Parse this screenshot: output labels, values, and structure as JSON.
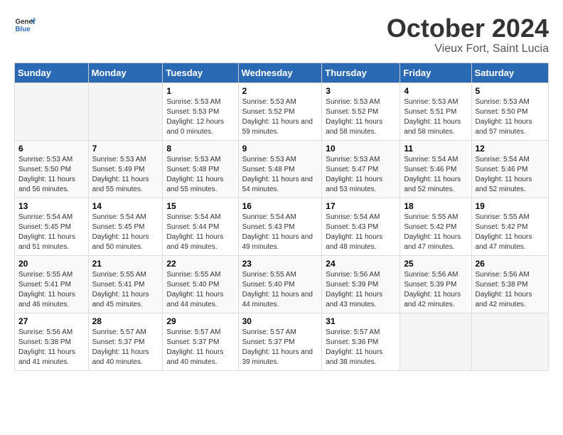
{
  "logo": {
    "line1": "General",
    "line2": "Blue"
  },
  "title": "October 2024",
  "subtitle": "Vieux Fort, Saint Lucia",
  "days_header": [
    "Sunday",
    "Monday",
    "Tuesday",
    "Wednesday",
    "Thursday",
    "Friday",
    "Saturday"
  ],
  "weeks": [
    [
      {
        "num": "",
        "sunrise": "",
        "sunset": "",
        "daylight": ""
      },
      {
        "num": "",
        "sunrise": "",
        "sunset": "",
        "daylight": ""
      },
      {
        "num": "1",
        "sunrise": "Sunrise: 5:53 AM",
        "sunset": "Sunset: 5:53 PM",
        "daylight": "Daylight: 12 hours and 0 minutes."
      },
      {
        "num": "2",
        "sunrise": "Sunrise: 5:53 AM",
        "sunset": "Sunset: 5:52 PM",
        "daylight": "Daylight: 11 hours and 59 minutes."
      },
      {
        "num": "3",
        "sunrise": "Sunrise: 5:53 AM",
        "sunset": "Sunset: 5:52 PM",
        "daylight": "Daylight: 11 hours and 58 minutes."
      },
      {
        "num": "4",
        "sunrise": "Sunrise: 5:53 AM",
        "sunset": "Sunset: 5:51 PM",
        "daylight": "Daylight: 11 hours and 58 minutes."
      },
      {
        "num": "5",
        "sunrise": "Sunrise: 5:53 AM",
        "sunset": "Sunset: 5:50 PM",
        "daylight": "Daylight: 11 hours and 57 minutes."
      }
    ],
    [
      {
        "num": "6",
        "sunrise": "Sunrise: 5:53 AM",
        "sunset": "Sunset: 5:50 PM",
        "daylight": "Daylight: 11 hours and 56 minutes."
      },
      {
        "num": "7",
        "sunrise": "Sunrise: 5:53 AM",
        "sunset": "Sunset: 5:49 PM",
        "daylight": "Daylight: 11 hours and 55 minutes."
      },
      {
        "num": "8",
        "sunrise": "Sunrise: 5:53 AM",
        "sunset": "Sunset: 5:48 PM",
        "daylight": "Daylight: 11 hours and 55 minutes."
      },
      {
        "num": "9",
        "sunrise": "Sunrise: 5:53 AM",
        "sunset": "Sunset: 5:48 PM",
        "daylight": "Daylight: 11 hours and 54 minutes."
      },
      {
        "num": "10",
        "sunrise": "Sunrise: 5:53 AM",
        "sunset": "Sunset: 5:47 PM",
        "daylight": "Daylight: 11 hours and 53 minutes."
      },
      {
        "num": "11",
        "sunrise": "Sunrise: 5:54 AM",
        "sunset": "Sunset: 5:46 PM",
        "daylight": "Daylight: 11 hours and 52 minutes."
      },
      {
        "num": "12",
        "sunrise": "Sunrise: 5:54 AM",
        "sunset": "Sunset: 5:46 PM",
        "daylight": "Daylight: 11 hours and 52 minutes."
      }
    ],
    [
      {
        "num": "13",
        "sunrise": "Sunrise: 5:54 AM",
        "sunset": "Sunset: 5:45 PM",
        "daylight": "Daylight: 11 hours and 51 minutes."
      },
      {
        "num": "14",
        "sunrise": "Sunrise: 5:54 AM",
        "sunset": "Sunset: 5:45 PM",
        "daylight": "Daylight: 11 hours and 50 minutes."
      },
      {
        "num": "15",
        "sunrise": "Sunrise: 5:54 AM",
        "sunset": "Sunset: 5:44 PM",
        "daylight": "Daylight: 11 hours and 49 minutes."
      },
      {
        "num": "16",
        "sunrise": "Sunrise: 5:54 AM",
        "sunset": "Sunset: 5:43 PM",
        "daylight": "Daylight: 11 hours and 49 minutes."
      },
      {
        "num": "17",
        "sunrise": "Sunrise: 5:54 AM",
        "sunset": "Sunset: 5:43 PM",
        "daylight": "Daylight: 11 hours and 48 minutes."
      },
      {
        "num": "18",
        "sunrise": "Sunrise: 5:55 AM",
        "sunset": "Sunset: 5:42 PM",
        "daylight": "Daylight: 11 hours and 47 minutes."
      },
      {
        "num": "19",
        "sunrise": "Sunrise: 5:55 AM",
        "sunset": "Sunset: 5:42 PM",
        "daylight": "Daylight: 11 hours and 47 minutes."
      }
    ],
    [
      {
        "num": "20",
        "sunrise": "Sunrise: 5:55 AM",
        "sunset": "Sunset: 5:41 PM",
        "daylight": "Daylight: 11 hours and 46 minutes."
      },
      {
        "num": "21",
        "sunrise": "Sunrise: 5:55 AM",
        "sunset": "Sunset: 5:41 PM",
        "daylight": "Daylight: 11 hours and 45 minutes."
      },
      {
        "num": "22",
        "sunrise": "Sunrise: 5:55 AM",
        "sunset": "Sunset: 5:40 PM",
        "daylight": "Daylight: 11 hours and 44 minutes."
      },
      {
        "num": "23",
        "sunrise": "Sunrise: 5:55 AM",
        "sunset": "Sunset: 5:40 PM",
        "daylight": "Daylight: 11 hours and 44 minutes."
      },
      {
        "num": "24",
        "sunrise": "Sunrise: 5:56 AM",
        "sunset": "Sunset: 5:39 PM",
        "daylight": "Daylight: 11 hours and 43 minutes."
      },
      {
        "num": "25",
        "sunrise": "Sunrise: 5:56 AM",
        "sunset": "Sunset: 5:39 PM",
        "daylight": "Daylight: 11 hours and 42 minutes."
      },
      {
        "num": "26",
        "sunrise": "Sunrise: 5:56 AM",
        "sunset": "Sunset: 5:38 PM",
        "daylight": "Daylight: 11 hours and 42 minutes."
      }
    ],
    [
      {
        "num": "27",
        "sunrise": "Sunrise: 5:56 AM",
        "sunset": "Sunset: 5:38 PM",
        "daylight": "Daylight: 11 hours and 41 minutes."
      },
      {
        "num": "28",
        "sunrise": "Sunrise: 5:57 AM",
        "sunset": "Sunset: 5:37 PM",
        "daylight": "Daylight: 11 hours and 40 minutes."
      },
      {
        "num": "29",
        "sunrise": "Sunrise: 5:57 AM",
        "sunset": "Sunset: 5:37 PM",
        "daylight": "Daylight: 11 hours and 40 minutes."
      },
      {
        "num": "30",
        "sunrise": "Sunrise: 5:57 AM",
        "sunset": "Sunset: 5:37 PM",
        "daylight": "Daylight: 11 hours and 39 minutes."
      },
      {
        "num": "31",
        "sunrise": "Sunrise: 5:57 AM",
        "sunset": "Sunset: 5:36 PM",
        "daylight": "Daylight: 11 hours and 38 minutes."
      },
      {
        "num": "",
        "sunrise": "",
        "sunset": "",
        "daylight": ""
      },
      {
        "num": "",
        "sunrise": "",
        "sunset": "",
        "daylight": ""
      }
    ]
  ]
}
